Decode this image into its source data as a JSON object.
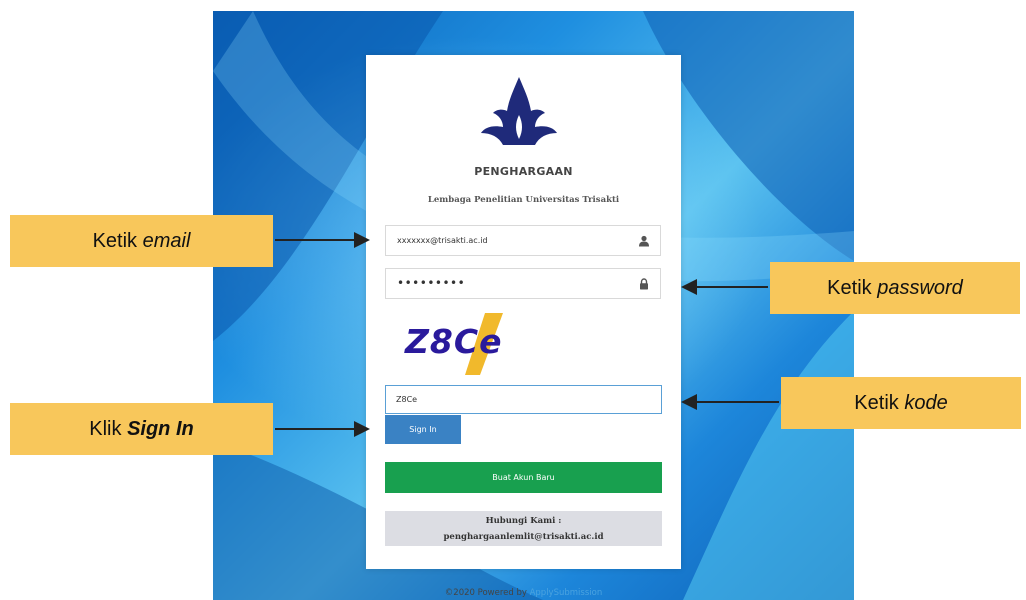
{
  "card": {
    "title": "PENGHARGAAN",
    "subtitle": "Lembaga Penelitian Universitas Trisakti"
  },
  "form": {
    "email_value": "xxxxxxx@trisakti.ac.id",
    "password_value": "•••••••••",
    "captcha_text": "Z8Ce",
    "code_value": "Z8Ce",
    "signin_label": "Sign In",
    "create_account_label": "Buat Akun Baru"
  },
  "contact": {
    "line1": "Hubungi Kami :",
    "line2": "penghargaanlemlit@trisakti.ac.id"
  },
  "footer": {
    "prefix": "©2020 Powered by ",
    "brand": "ApplySubmission"
  },
  "callouts": {
    "email_plain": "Ketik ",
    "email_em": "email",
    "password_plain": "Ketik ",
    "password_em": "password",
    "code_plain": "Ketik ",
    "code_em": "kode",
    "signin_plain": "Klik ",
    "signin_em": "Sign In"
  },
  "icons": {
    "email_field_icon": "user-icon",
    "password_field_icon": "lock-icon"
  },
  "colors": {
    "callout_bg": "#f8c75b",
    "signin_button": "#3a82c4",
    "create_account_button": "#18a04f",
    "logo": "#1f2a7a"
  }
}
